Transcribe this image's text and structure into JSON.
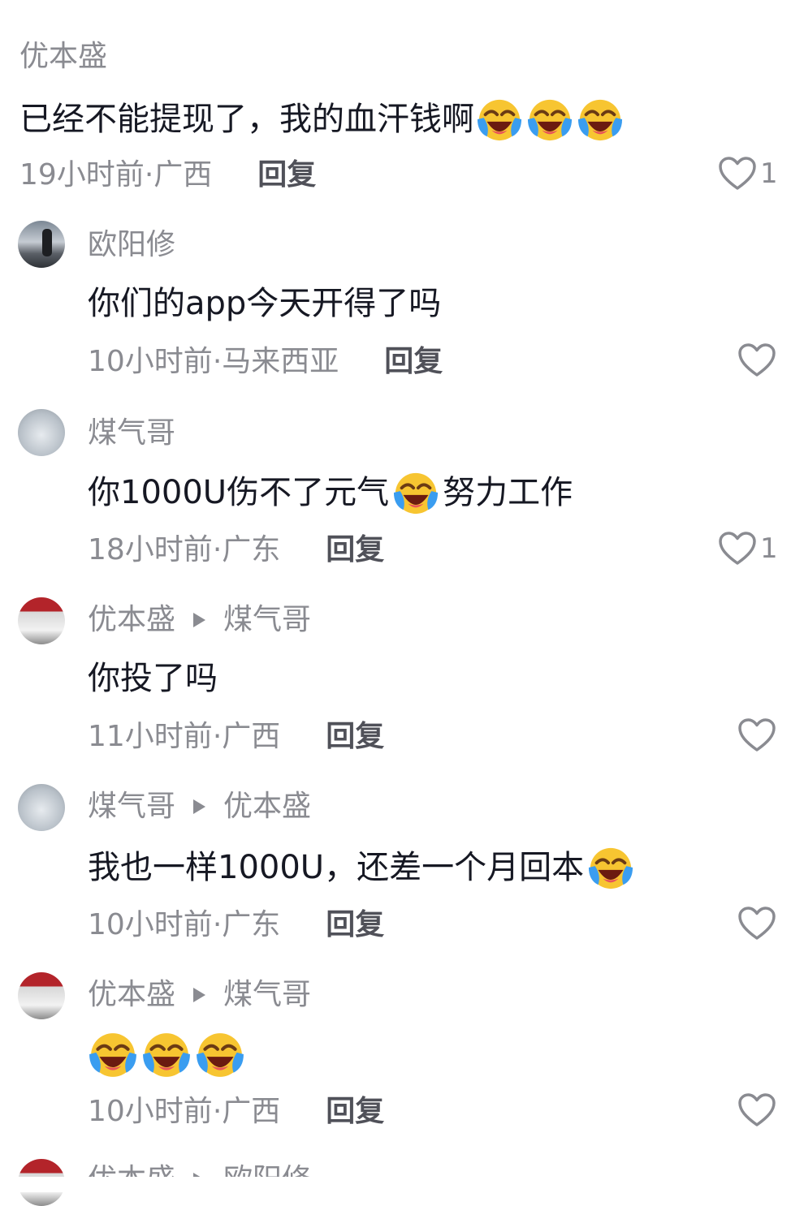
{
  "comments": [
    {
      "name": "优本盛",
      "text": "已经不能提现了，我的血汗钱啊",
      "time": "19小时前",
      "location": "广西",
      "reply": "回复",
      "likes": "1",
      "emoji": [
        "crying-laugh-icon",
        "crying-laugh-icon",
        "crying-laugh-icon"
      ]
    },
    {
      "name": "欧阳修",
      "text": "你们的app今天开得了吗",
      "time": "10小时前",
      "location": "马来西亚",
      "reply": "回复"
    },
    {
      "name": "煤气哥",
      "text_before": "你1000U伤不了元气",
      "text_after": "努力工作",
      "time": "18小时前",
      "location": "广东",
      "reply": "回复",
      "likes": "1"
    },
    {
      "name": "优本盛",
      "reply_to": "煤气哥",
      "text": "你投了吗",
      "time": "11小时前",
      "location": "广西",
      "reply": "回复"
    },
    {
      "name": "煤气哥",
      "reply_to": "优本盛",
      "text": "我也一样1000U，还差一个月回本",
      "time": "10小时前",
      "location": "广东",
      "reply": "回复"
    },
    {
      "name": "优本盛",
      "reply_to": "煤气哥",
      "time": "10小时前",
      "location": "广西",
      "reply": "回复",
      "emoji": [
        "crying-laugh-icon",
        "crying-laugh-icon",
        "crying-laugh-icon"
      ]
    },
    {
      "name": "优本盛",
      "reply_to": "欧阳修"
    }
  ],
  "meta_separator": " · ",
  "colors": {
    "text": "#161823",
    "secondary": "#8a8b91",
    "emoji_face": "#f7c531",
    "emoji_tear": "#3a9df0"
  }
}
